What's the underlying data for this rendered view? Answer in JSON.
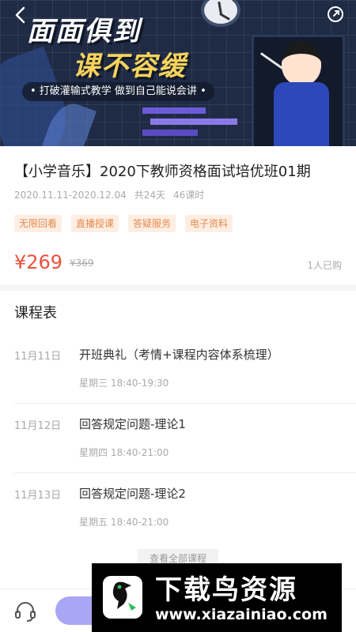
{
  "banner": {
    "headline_1": "面面俱到",
    "headline_2": "课不容缓",
    "slogan": "• 打破灌输式教学  做到自己能说会讲 •"
  },
  "course": {
    "title": "【小学音乐】2020下教师资格面试培优班01期",
    "date_range": "2020.11.11-2020.12.04",
    "total_days": "共24天",
    "lesson_count": "46课时",
    "tags": [
      "无限回看",
      "直播授课",
      "答疑服务",
      "电子资料"
    ],
    "price": "¥269",
    "original_price": "¥369",
    "buyers": "1人已购"
  },
  "schedule": {
    "title": "课程表",
    "lessons": [
      {
        "date": "11月11日",
        "name": "开班典礼（考情+课程内容体系梳理）",
        "time": "星期三 18:40-19:30"
      },
      {
        "date": "11月12日",
        "name": "回答规定问题-理论1",
        "time": "星期四 18:40-21:00"
      },
      {
        "date": "11月13日",
        "name": "回答规定问题-理论2",
        "time": "星期五 18:40-21:00"
      }
    ],
    "view_all": "查看全部课程"
  },
  "watermark": {
    "name": "下载鸟资源",
    "url": "www.xiazainiao.com"
  },
  "colors": {
    "price": "#e8523c",
    "tag_text": "#e58a4e",
    "tag_bg": "#fdeee4",
    "buy_button": "#a9a6f5"
  }
}
